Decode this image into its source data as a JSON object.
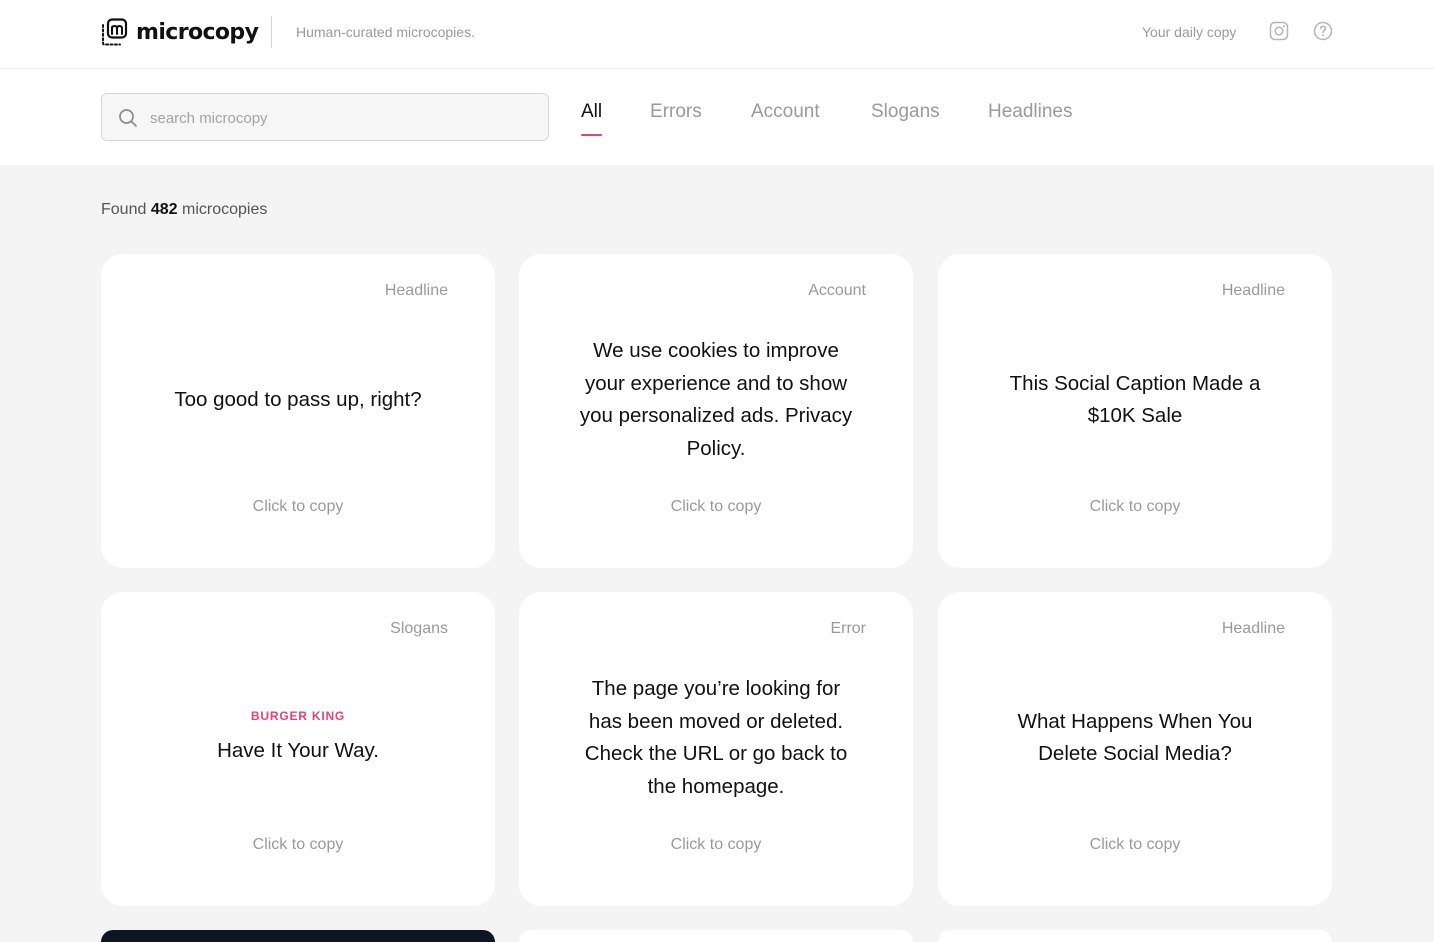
{
  "brand": {
    "logo_text": "microcopy",
    "tagline": "Human-curated microcopies."
  },
  "header": {
    "daily_link": "Your daily copy",
    "icons": [
      "instagram-icon",
      "help-circle-icon"
    ]
  },
  "search": {
    "placeholder": "search microcopy",
    "value": ""
  },
  "tabs": [
    {
      "label": "All",
      "active": true
    },
    {
      "label": "Errors",
      "active": false
    },
    {
      "label": "Account",
      "active": false
    },
    {
      "label": "Slogans",
      "active": false
    },
    {
      "label": "Headlines",
      "active": false
    }
  ],
  "results": {
    "prefix": "Found",
    "count": "482",
    "suffix": "microcopies"
  },
  "cards": [
    {
      "tag": "Headline",
      "brand": "",
      "text": "Too good to pass up, right?",
      "copy_label": "Click to copy"
    },
    {
      "tag": "Account",
      "brand": "",
      "text": "We use cookies to improve your experience and to show you personalized ads. Privacy Policy.",
      "copy_label": "Click to copy"
    },
    {
      "tag": "Headline",
      "brand": "",
      "text": "This Social Caption Made a $10K Sale",
      "copy_label": "Click to copy"
    },
    {
      "tag": "Slogans",
      "brand": "BURGER KING",
      "text": "Have It Your Way.",
      "copy_label": "Click to copy"
    },
    {
      "tag": "Error",
      "brand": "",
      "text": "The page you’re looking for has been moved or deleted. Check the URL or go back to the homepage.",
      "copy_label": "Click to copy"
    },
    {
      "tag": "Headline",
      "brand": "",
      "text": "What Happens When You Delete Social Media?",
      "copy_label": "Click to copy"
    }
  ],
  "colors": {
    "accent": "#e8407a",
    "page_bg": "#f4f4f4",
    "card_bg": "#ffffff",
    "dark_card_bg": "#0f1422",
    "muted_text": "#9a9a9a"
  }
}
